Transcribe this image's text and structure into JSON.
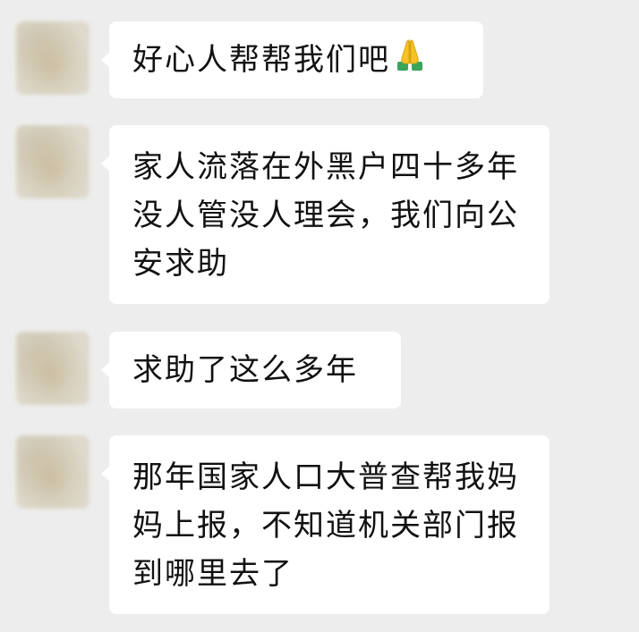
{
  "messages": [
    {
      "text": "好心人帮帮我们吧",
      "emoji": "folded-hands"
    },
    {
      "text": "家人流落在外黑户四十多年没人管没人理会，我们向公安求助"
    },
    {
      "text": "求助了这么多年"
    },
    {
      "text": "那年国家人口大普查帮我妈妈上报，不知道机关部门报到哪里去了"
    }
  ],
  "colors": {
    "background": "#ededed",
    "bubble": "#ffffff",
    "text": "#111111",
    "emoji_yellow": "#f5c325",
    "emoji_sleeve": "#3ba55c"
  }
}
